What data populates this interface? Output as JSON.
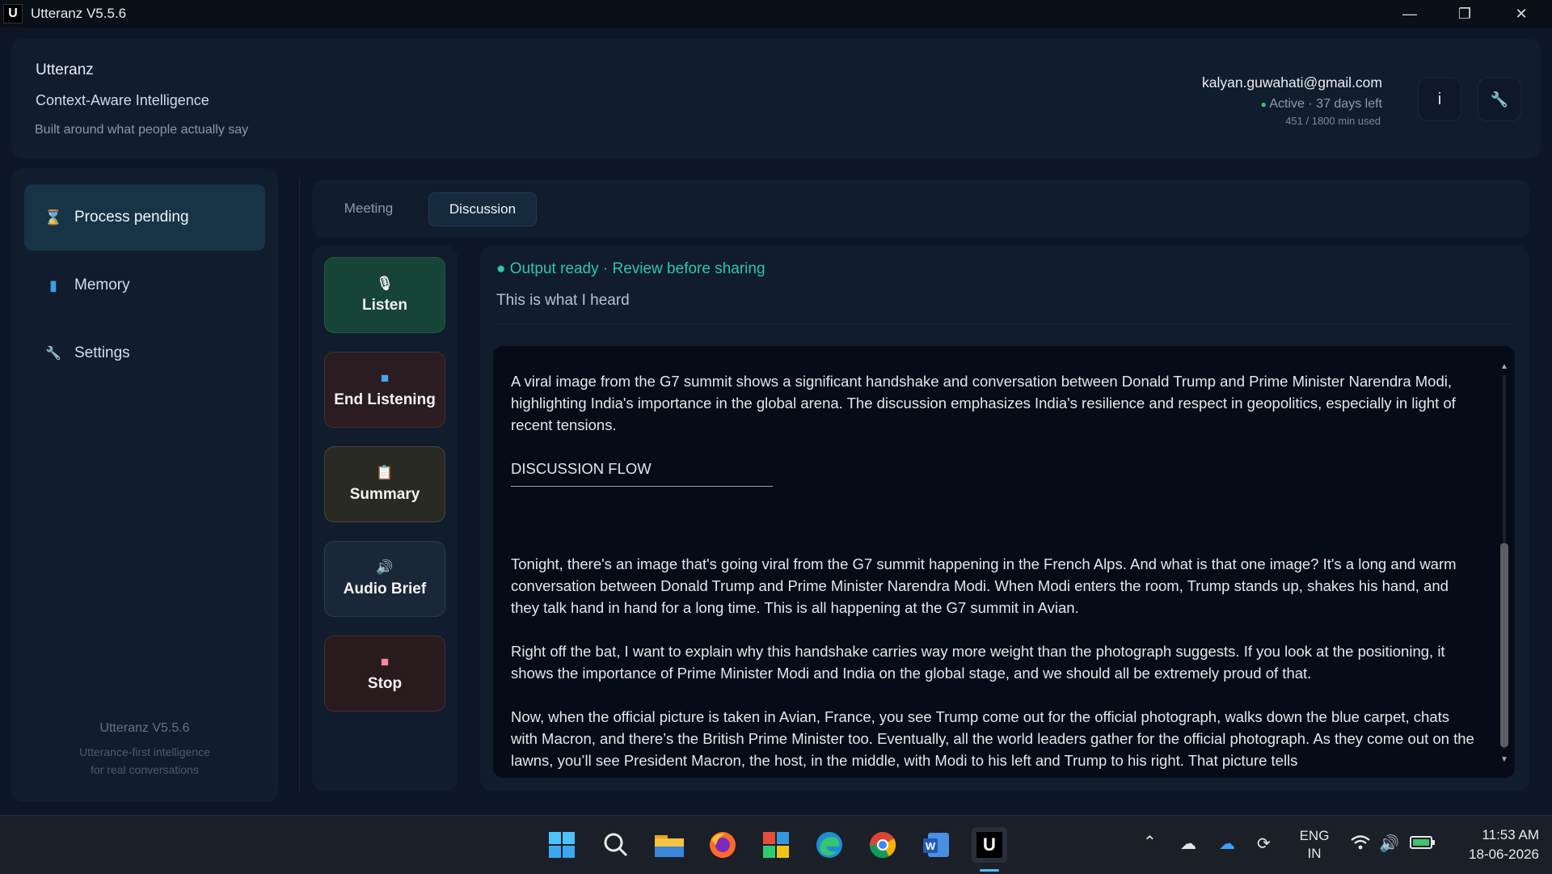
{
  "window": {
    "title": "Utteranz V5.5.6",
    "icon_letter": "U",
    "min_glyph": "—",
    "max_glyph": "❐",
    "close_glyph": "✕"
  },
  "header": {
    "app_name": "Utteranz",
    "tagline": "Context-Aware Intelligence",
    "subtitle": "Built around what people actually say",
    "email": "kalyan.guwahati@gmail.com",
    "status_dot": "●",
    "status": "Active · 37 days left",
    "usage": "451 / 1800 min used",
    "info_label": "i",
    "tools_glyph": "🔧",
    "status_color": "#2ecc71"
  },
  "sidebar": {
    "items": [
      {
        "label": "Process pending",
        "icon": "hourglass-icon",
        "glyph": "⌛"
      },
      {
        "label": "Memory",
        "icon": "book-icon",
        "glyph": "▮"
      },
      {
        "label": "Settings",
        "icon": "wrench-icon",
        "glyph": "🔧"
      }
    ],
    "footer_version": "Utteranz V5.5.6",
    "footer_line1": "Utterance-first intelligence",
    "footer_line2": "for real conversations"
  },
  "tabs": [
    {
      "label": "Meeting"
    },
    {
      "label": "Discussion"
    }
  ],
  "actions": [
    {
      "label": "Listen",
      "icon": "microphone-icon",
      "glyph": "🎙"
    },
    {
      "label": "End Listening",
      "icon": "stop-square-icon",
      "glyph": "■"
    },
    {
      "label": "Summary",
      "icon": "clipboard-icon",
      "glyph": "📋"
    },
    {
      "label": "Audio Brief",
      "icon": "speaker-icon",
      "glyph": "🔊"
    },
    {
      "label": "Stop",
      "icon": "stop-icon",
      "glyph": "■"
    }
  ],
  "output": {
    "status": "● Output ready · Review before sharing",
    "heard": "This is what I heard",
    "intro": "A viral image from the G7 summit shows a significant handshake and conversation between Donald Trump and Prime Minister Narendra Modi, highlighting India's importance in the global arena. The discussion emphasizes India's resilience and respect in geopolitics, especially in light of recent tensions.",
    "section_title": "DISCUSSION FLOW",
    "para1": "Tonight, there's an image that's going viral from the G7 summit happening in the French Alps. And what is that one image? It's a long and warm conversation between Donald Trump and Prime Minister Narendra Modi. When Modi enters the room, Trump stands up, shakes his hand, and they talk hand in hand for a long time. This is all happening at the G7 summit in Avian.",
    "para2": "Right off the bat, I want to explain why this handshake carries way more weight than the photograph suggests. If you look at the positioning, it shows the importance of Prime Minister Modi and India on the global stage, and we should all be extremely proud of that.",
    "para3": "Now, when the official picture is taken in Avian, France, you see Trump come out for the official photograph, walks down the blue carpet, chats with Macron, and there’s the British Prime Minister too. Eventually, all the world leaders gather for the official photograph. As they come out on the lawns, you’ll see President Macron, the host, in the middle, with Modi to his left and Trump to his right. That picture tells",
    "scroll_up": "▲",
    "scroll_down": "▼"
  },
  "taskbar": {
    "apps": [
      "start-icon",
      "search-icon",
      "file-explorer-icon",
      "firefox-icon",
      "photos-icon",
      "edge-icon",
      "chrome-icon",
      "word-icon",
      "utteranz-icon"
    ],
    "utteranz_letter": "U",
    "lang1": "ENG",
    "lang2": "IN",
    "time": "11:53 AM",
    "date": "18-06-2026"
  }
}
